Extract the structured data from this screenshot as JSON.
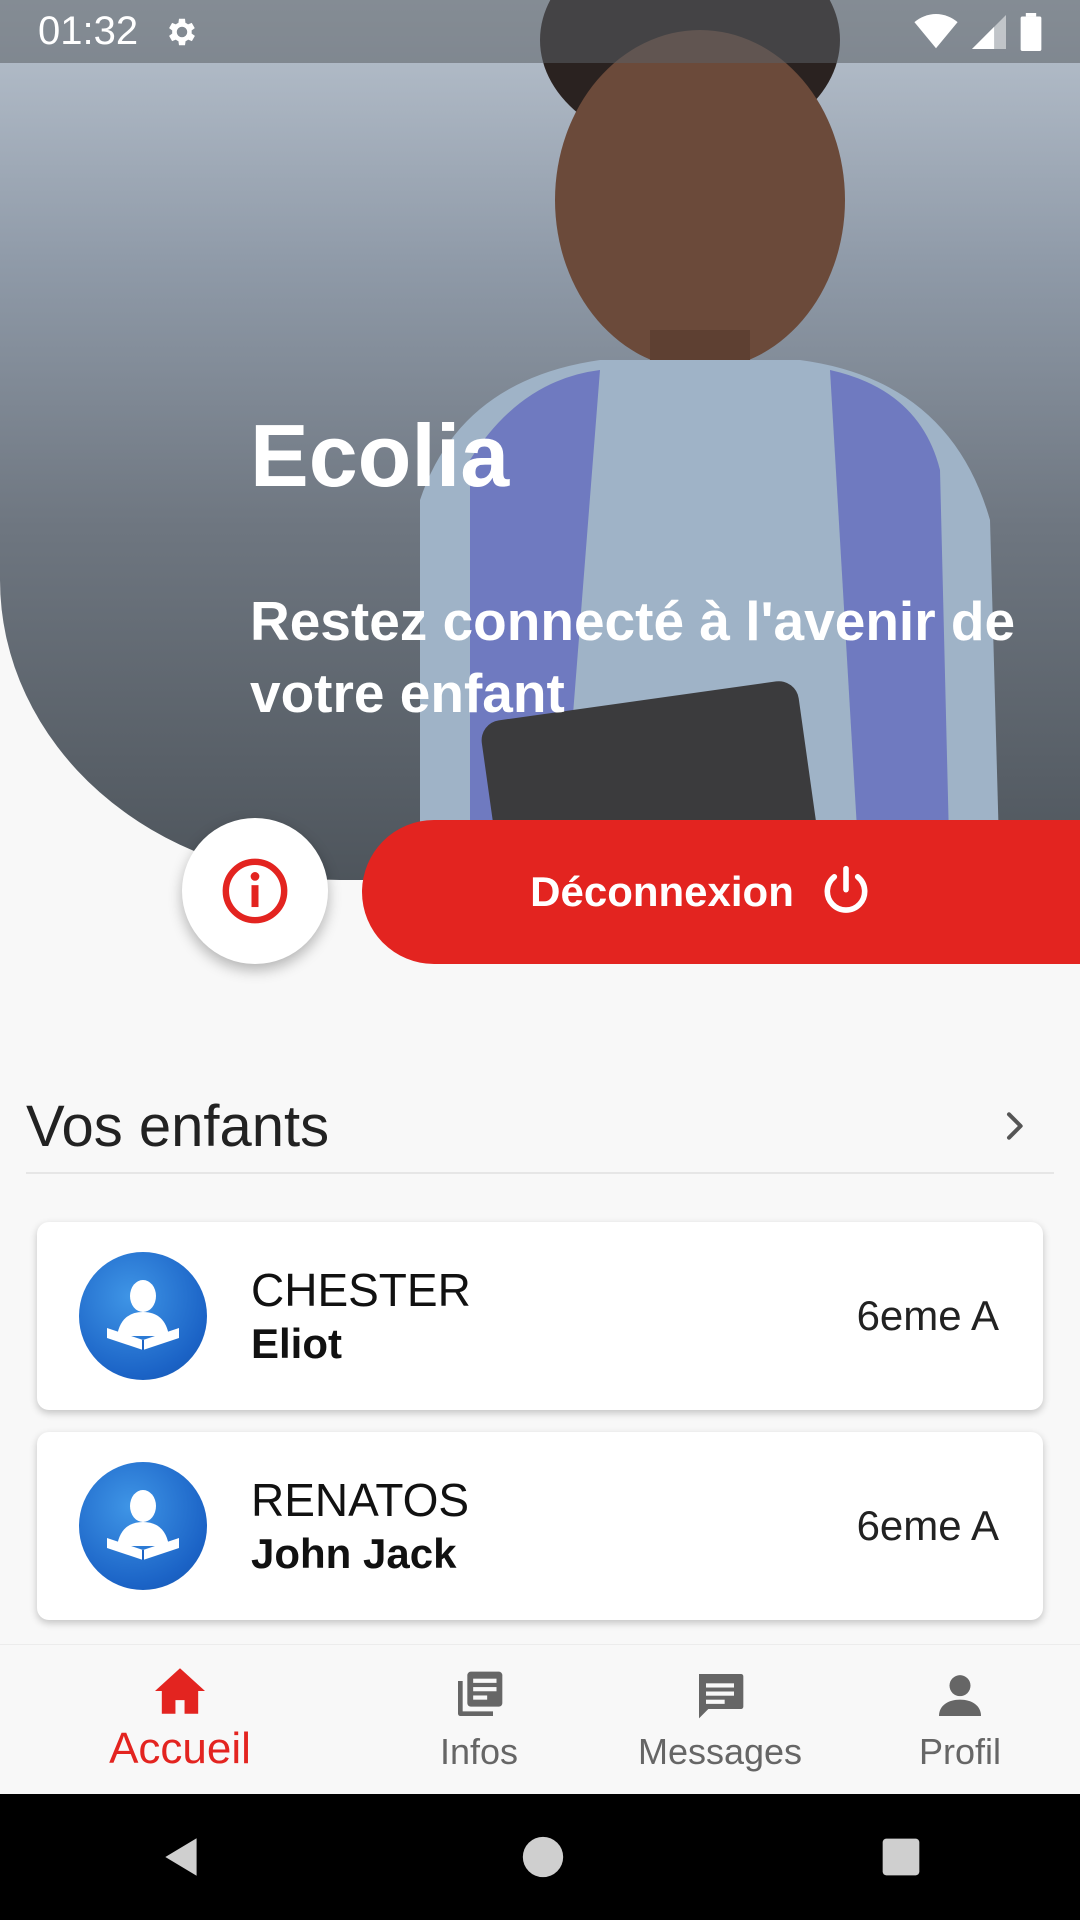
{
  "status_bar": {
    "time": "01:32"
  },
  "hero": {
    "title": "Ecolia",
    "tagline": "Restez connecté à l'avenir de votre enfant"
  },
  "actions": {
    "logout_label": "Déconnexion"
  },
  "children_section": {
    "title": "Vos enfants",
    "children": [
      {
        "last_name": "CHESTER",
        "first_name": "Eliot",
        "class": "6eme A"
      },
      {
        "last_name": "RENATOS",
        "first_name": "John Jack",
        "class": "6eme A"
      }
    ]
  },
  "bottom_nav": {
    "items": [
      {
        "label": "Accueil",
        "icon": "home-icon",
        "active": true
      },
      {
        "label": "Infos",
        "icon": "news-icon",
        "active": false
      },
      {
        "label": "Messages",
        "icon": "chat-icon",
        "active": false
      },
      {
        "label": "Profil",
        "icon": "person-icon",
        "active": false
      }
    ]
  },
  "colors": {
    "accent": "#e32420",
    "avatar": "#1b63c6"
  }
}
